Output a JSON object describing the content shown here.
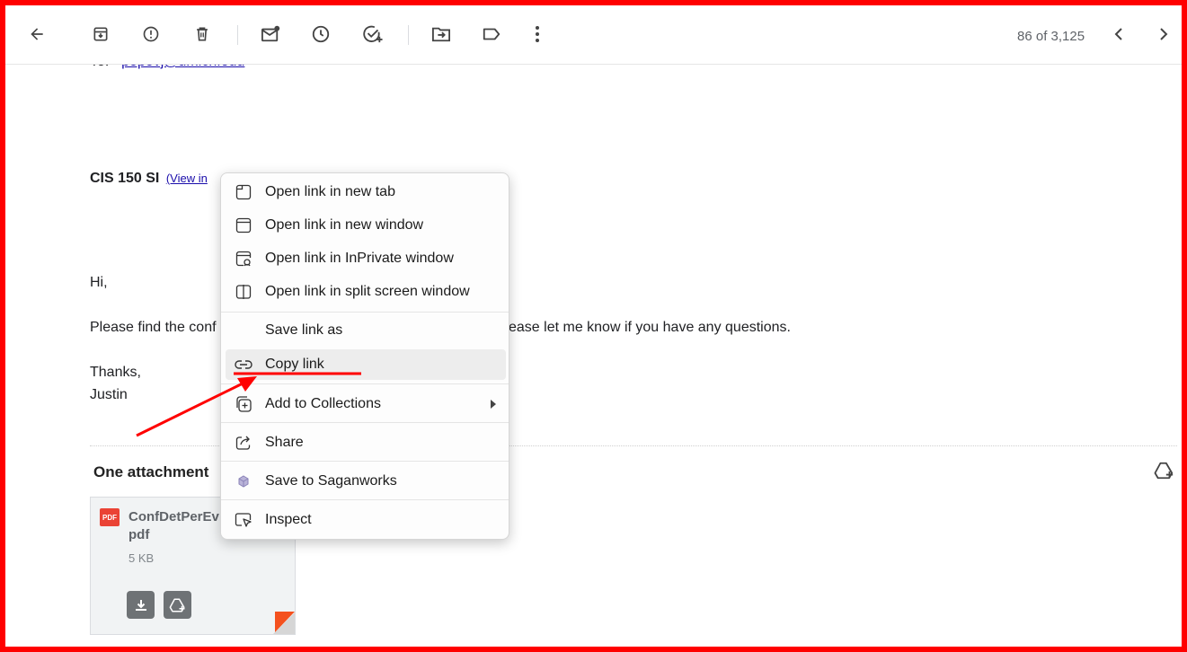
{
  "toolbar": {
    "pager_text": "86 of 3,125",
    "icons": [
      "back-arrow-icon",
      "archive-icon",
      "report-spam-icon",
      "delete-icon",
      "mark-unread-icon",
      "snooze-icon",
      "add-task-icon",
      "move-to-icon",
      "label-icon",
      "more-vert-icon",
      "chevron-left-icon",
      "chevron-right-icon"
    ]
  },
  "email": {
    "to_prefix": "To: <",
    "to_address": "popovj@umich.edu",
    "to_suffix": ">",
    "subject_bold": "CIS 150 SI",
    "subject_link": "(View in ",
    "greeting": "Hi,",
    "body_start": "Please find the conf",
    "body_end": "ease let me know if you have any questions.",
    "sign_off": "Thanks,",
    "signature": "Justin"
  },
  "attachments": {
    "title": "One attachment",
    "file": {
      "type_badge": "PDF",
      "name": "ConfDetPerEv pdf",
      "size": "5 KB"
    }
  },
  "context_menu": {
    "items": [
      {
        "label": "Open link in new tab",
        "icon": "new-tab-icon"
      },
      {
        "label": "Open link in new window",
        "icon": "new-window-icon"
      },
      {
        "label": "Open link in InPrivate window",
        "icon": "inprivate-window-icon"
      },
      {
        "label": "Open link in split screen window",
        "icon": "split-screen-icon"
      },
      {
        "label": "Save link as",
        "icon": ""
      },
      {
        "label": "Copy link",
        "icon": "link-icon",
        "highlighted": true
      },
      {
        "label": "Add to Collections",
        "icon": "collections-icon",
        "has_submenu": true
      },
      {
        "label": "Share",
        "icon": "share-icon"
      },
      {
        "label": "Save to Saganworks",
        "icon": "saganworks-icon"
      },
      {
        "label": "Inspect",
        "icon": "inspect-icon"
      }
    ]
  },
  "colors": {
    "annotation_red": "#ff0000",
    "link_blue": "#1a0dab",
    "pdf_red": "#ea4335"
  }
}
